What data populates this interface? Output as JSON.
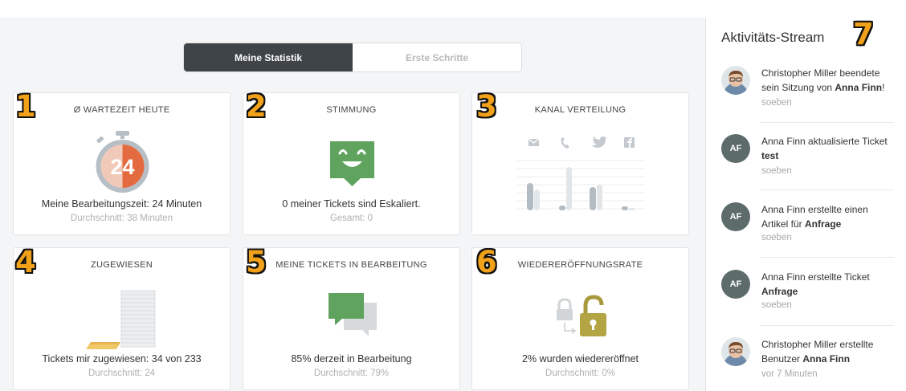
{
  "tabs": [
    {
      "label": "Meine Statistik",
      "active": true
    },
    {
      "label": "Erste Schritte",
      "active": false
    }
  ],
  "cards": {
    "wartezeit": {
      "number": "1",
      "title": "Ø WARTEZEIT HEUTE",
      "value": "24",
      "main": "Meine Bearbeitungszeit: 24 Minuten",
      "sub": "Durchschnitt: 38 Minuten"
    },
    "stimmung": {
      "number": "2",
      "title": "STIMMUNG",
      "main": "0 meiner Tickets sind Eskaliert.",
      "sub": "Gesamt: 0"
    },
    "kanal": {
      "number": "3",
      "title": "KANAL VERTEILUNG",
      "channels": [
        "email-icon",
        "phone-icon",
        "twitter-icon",
        "facebook-icon"
      ]
    },
    "zugewiesen": {
      "number": "4",
      "title": "ZUGEWIESEN",
      "main": "Tickets mir zugewiesen: 34 von 233",
      "sub": "Durchschnitt: 24"
    },
    "bearbeitung": {
      "number": "5",
      "title": "MEINE TICKETS IN BEARBEITUNG",
      "main": "85% derzeit in Bearbeitung",
      "sub": "Durchschnitt: 79%"
    },
    "wiedereroeffnung": {
      "number": "6",
      "title": "WIEDERERÖFFNUNGSRATE",
      "main": "2% wurden wiedereröffnet",
      "sub": "Durchschnitt: 0%"
    }
  },
  "sidebar": {
    "number": "7",
    "title": "Aktivitäts-Stream",
    "activities": [
      {
        "avatar": "photo",
        "pre": "Christopher Miller beendete sein Sitzung von ",
        "bold": "Anna Finn",
        "post": "!",
        "time": "soeben"
      },
      {
        "avatar": "AF",
        "pre": "Anna Finn aktualisierte Ticket ",
        "bold": "test",
        "post": "",
        "time": "soeben"
      },
      {
        "avatar": "AF",
        "pre": "Anna Finn erstellte einen Artikel für  ",
        "bold": "Anfrage",
        "post": "",
        "time": "soeben"
      },
      {
        "avatar": "AF",
        "pre": "Anna Finn erstellte Ticket ",
        "bold": "Anfrage",
        "post": "",
        "time": "soeben"
      },
      {
        "avatar": "photo",
        "pre": "Christopher Miller erstellte Benutzer ",
        "bold": "Anna Finn",
        "post": "",
        "time": "vor 7 Minuten"
      }
    ]
  },
  "colors": {
    "accent_green": "#5fa35f",
    "accent_orange": "#e36b3f",
    "callout_orange": "#f2a11a",
    "tab_active": "#3f4449"
  }
}
